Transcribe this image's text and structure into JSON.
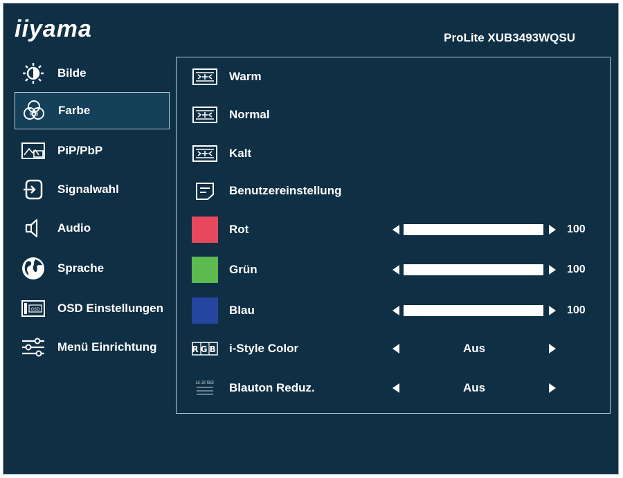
{
  "brand": "iiyama",
  "model": "ProLite XUB3493WQSU",
  "sidebar": {
    "items": [
      {
        "label": "Bilde",
        "icon": "brightness-icon"
      },
      {
        "label": "Farbe",
        "icon": "color-icon"
      },
      {
        "label": "PiP/PbP",
        "icon": "pip-icon"
      },
      {
        "label": "Signalwahl",
        "icon": "input-icon"
      },
      {
        "label": "Audio",
        "icon": "speaker-icon"
      },
      {
        "label": "Sprache",
        "icon": "globe-icon"
      },
      {
        "label": "OSD Einstellungen",
        "icon": "osd-icon"
      },
      {
        "label": "Menü Einrichtung",
        "icon": "sliders-icon"
      }
    ],
    "active_index": 1
  },
  "panel": {
    "presets": [
      {
        "label": "Warm",
        "icon": "color-temp-icon"
      },
      {
        "label": "Normal",
        "icon": "color-temp-icon"
      },
      {
        "label": "Kalt",
        "icon": "color-temp-icon"
      }
    ],
    "user_setting": {
      "label": "Benutzereinstellung",
      "icon": "user-setting-icon"
    },
    "sliders": [
      {
        "label": "Rot",
        "color": "#e8485e",
        "value": "100",
        "level": 1.0
      },
      {
        "label": "Grün",
        "color": "#5cba4e",
        "value": "100",
        "level": 1.0
      },
      {
        "label": "Blau",
        "color": "#2446a0",
        "value": "100",
        "level": 1.0
      }
    ],
    "istyle": {
      "label": "i-Style Color",
      "icon_text": "RGB",
      "value": "Aus"
    },
    "blue_light": {
      "label": "Blauton Reduz.",
      "icon_text": "BLUE LIGHT REDUCER",
      "value": "Aus"
    }
  }
}
